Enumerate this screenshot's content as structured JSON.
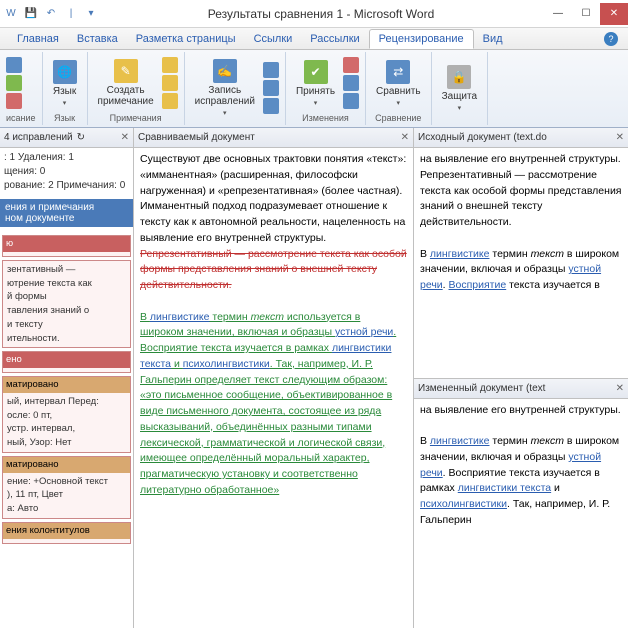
{
  "titlebar": {
    "title": "Результаты сравнения 1 - Microsoft Word"
  },
  "qat": {
    "save": "💾",
    "undo": "↶",
    "sep": "|",
    "drop": "▾"
  },
  "tabs": [
    "Главная",
    "Вставка",
    "Разметка страницы",
    "Ссылки",
    "Рассылки",
    "Рецензирование",
    "Вид"
  ],
  "active_tab": 5,
  "ribbon": {
    "g1": {
      "label": "исание",
      "btns": [
        {
          "l1": "ABC"
        }
      ]
    },
    "g2": {
      "label": "Язык",
      "btns": [
        {
          "l": "Язык"
        }
      ]
    },
    "g3": {
      "label": "Примечания",
      "btns": [
        {
          "l": "Создать\nпримечание"
        }
      ]
    },
    "g4": {
      "label": "",
      "btns": [
        {
          "l": "Запись\nисправлений"
        }
      ]
    },
    "g5": {
      "label": "Изменения",
      "btns": [
        {
          "l": "Принять"
        }
      ]
    },
    "g6": {
      "label": "Сравнение",
      "btns": [
        {
          "l": "Сравнить"
        }
      ]
    },
    "g7": {
      "label": "",
      "btns": [
        {
          "l": "Защита"
        }
      ]
    }
  },
  "left_pane": {
    "title": "4 исправлений",
    "stats1": ": 1 Удаления: 1",
    "stats2": "щения: 0",
    "stats3": "рование: 2 Примечания: 0",
    "panel_title": "ения и примечания\nном документе",
    "boxes": [
      {
        "hdr": "ю",
        "hdrcls": "red",
        "body": ""
      },
      {
        "hdr": "",
        "body": "зентативный —\nютрение текста как\nй формы\nтавления знаний о\nи тексту\nительности."
      },
      {
        "hdr": "ено",
        "hdrcls": "red",
        "body": ""
      },
      {
        "hdr": "матировано",
        "body": "ый, интервал Перед:\nосле: 0 пт,\nустр. интервал,\nный, Узор: Нет"
      },
      {
        "hdr": "матировано",
        "body": "ение: +Основной текст\n), 11 пт, Цвет\nа: Авто"
      },
      {
        "hdr": "ения колонтитулов",
        "body": ""
      }
    ]
  },
  "center_pane": {
    "title": "Сравниваемый документ",
    "p1": "Существуют две основных трактовки понятия «текст»: «имманентная» (расширенная, философски нагруженная) и «репрезентативная» (более частная). Имманентный подход подразумевает отношение к тексту как к автономной реальности, нацеленность на выявление его внутренней структуры.",
    "del1": "Репрезентативный — рассмотрение текста как особой формы представления знаний о внешней тексту действительности.",
    "p2a": "В ",
    "link1": "лингвистике",
    "p2b": " термин ",
    "ital1": "текст",
    "p2c": " используется в широком значении, включая и образцы ",
    "link2": "устной речи",
    "p2d": ". Восприятие текста изучается в рамках ",
    "link3": "лингвистики текста",
    "p2e": " и ",
    "link4": "психолингвистики",
    "p2f": ". Так, например, И. Р. Гальперин определяет текст следующим образом: «это письменное сообщение, объективированное в виде письменного документа, состоящее из ряда высказываний, объединённых разными типами лексической, грамматической и логической связи, имеющее определённый моральный характер, прагматическую установку и соответственно литературно обработанное»"
  },
  "right_top": {
    "title": "Исходный документ (text.do",
    "p1": "на выявление его внутренней структуры. Репрезентативный — рассмотрение текста как особой формы представления знаний о внешней тексту действительности.",
    "p2a": "В ",
    "link1": "лингвистике",
    "p2b": " термин ",
    "ital1": "текст",
    "p2c": " в широком значении, включая и образцы ",
    "link2": "устной речи",
    "p2d": ". ",
    "link3": "Восприятие",
    "p2e": " текста изучается в"
  },
  "right_bottom": {
    "title": "Измененный документ (text",
    "p1": "на выявление его внутренней структуры.",
    "p2a": "В ",
    "link1": "лингвистике",
    "p2b": " термин ",
    "ital1": "текст",
    "p2c": " в широком значении, включая и образцы ",
    "link2": "устной речи",
    "p2d": ". Восприятие текста изучается в рамках ",
    "link3": "лингвистики текста",
    "p2e": " и ",
    "link4": "психолингвистики",
    "p2f": ". Так, например, И. Р. Гальперин"
  }
}
